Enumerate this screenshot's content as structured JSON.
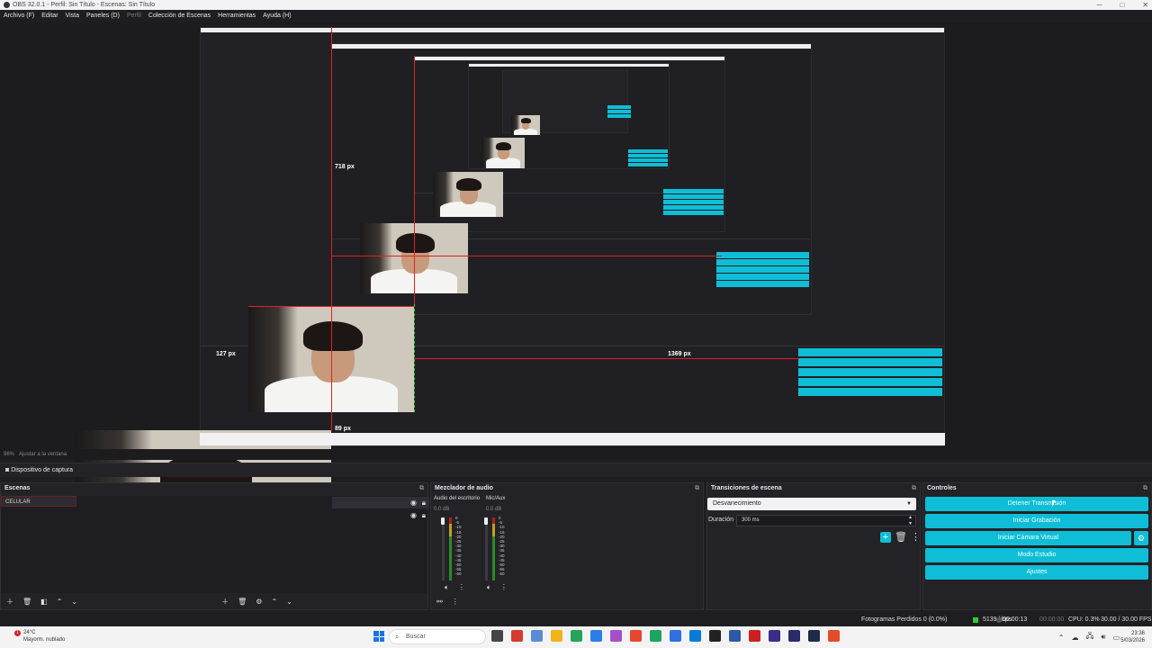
{
  "window": {
    "title": "OBS 32.0.1 - Perfil: Sin Título - Escenas: Sin Título",
    "minimize": "─",
    "maximize": "□",
    "close": "✕"
  },
  "menu": {
    "items": [
      "Archivo (F)",
      "Editar",
      "Vista",
      "Paneles (D)",
      "Perfil",
      "Colección de Escenas",
      "Herramientas",
      "Ayuda (H)"
    ]
  },
  "preview": {
    "labels": {
      "a": "718 px",
      "b": "127 px",
      "c": "1369 px",
      "d": "89 px"
    }
  },
  "zoom": {
    "value": "96%",
    "fit": "Ajustar a la ventana"
  },
  "source_bar": {
    "label": "Dispositivo de captura"
  },
  "scenes": {
    "header": "Escenas",
    "items": [
      "CELULAR"
    ]
  },
  "mixer": {
    "header": "Mezclador de audio",
    "channels": [
      {
        "name": "Audio del escritorio",
        "db": "0.0 dB"
      },
      {
        "name": "Mic/Aux",
        "db": "0.0 dB"
      }
    ],
    "scale": [
      "0",
      "-5",
      "-10",
      "-15",
      "-20",
      "-25",
      "-30",
      "-35",
      "-40",
      "-45",
      "-50",
      "-55",
      "-60"
    ]
  },
  "transitions": {
    "header": "Transiciones de escena",
    "selected": "Desvanecimiento",
    "duration_label": "Duración",
    "duration_value": "300 ms"
  },
  "controls": {
    "header": "Controles",
    "buttons": [
      "Detener Transmisión",
      "Iniciar Grabación",
      "Iniciar Cámara Virtual",
      "Modo Estudio",
      "Ajustes"
    ]
  },
  "status": {
    "dropped": "Fotogramas Perdidos 0 (0.0%)",
    "bitrate": "5139 kbps",
    "stream_time": "00:00:13",
    "rec_time": "00:00:00",
    "cpu": "CPU: 0.3%",
    "fps": "30.00 / 30.00 FPS"
  },
  "taskbar": {
    "weather_temp": "24°C",
    "weather_desc": "Mayorm. nublado",
    "search_placeholder": "Buscar",
    "alert_count": "1",
    "time": "23:36",
    "date": "5/03/2026",
    "icon_colors": [
      "#444444",
      "#d63a2e",
      "#5b8bd4",
      "#f2b21b",
      "#25a45a",
      "#2b7de9",
      "#a74ec6",
      "#e8462f",
      "#1ea362",
      "#2f6fe0",
      "#0b7ad6",
      "#222222",
      "#2c59a8",
      "#cc2020",
      "#3d2d8a",
      "#2b2b6b",
      "#1d2a4a",
      "#e34c26"
    ]
  }
}
